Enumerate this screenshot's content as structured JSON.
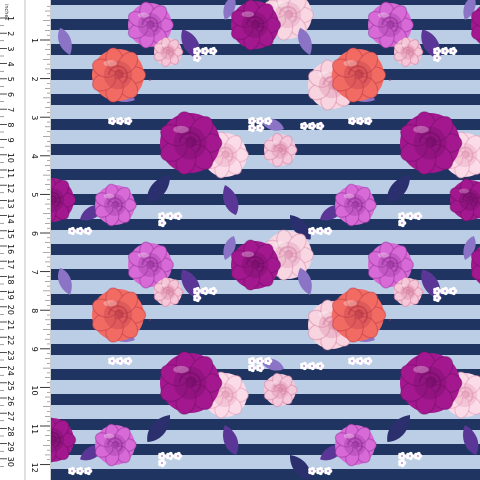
{
  "ruler": {
    "unit_label": "inches",
    "cm_labels": [
      "1",
      "2",
      "3",
      "4",
      "5",
      "6",
      "7",
      "8",
      "9",
      "10",
      "11",
      "12",
      "13",
      "14",
      "15",
      "16",
      "17",
      "18",
      "19",
      "20",
      "21",
      "22",
      "23",
      "24",
      "25",
      "26",
      "27",
      "28",
      "29",
      "30"
    ],
    "inch_labels": [
      "1",
      "2",
      "3",
      "4",
      "5",
      "6",
      "7",
      "8",
      "9",
      "10",
      "11",
      "12"
    ]
  },
  "pattern": {
    "description_colors": {
      "stripe_light": "#bccde6",
      "stripe_dark": "#1f3461",
      "magenta_rose": "#a3188f",
      "magenta_dark": "#6e0d63",
      "pink_rose": "#f6c7d8",
      "coral_rose": "#f26b63",
      "orchid": "#d76ad6",
      "leaf_purple": "#5a3796",
      "leaf_lilac": "#8b74c6",
      "leaf_navy": "#2b2f6e",
      "blossom_white": "#ffffff"
    }
  }
}
